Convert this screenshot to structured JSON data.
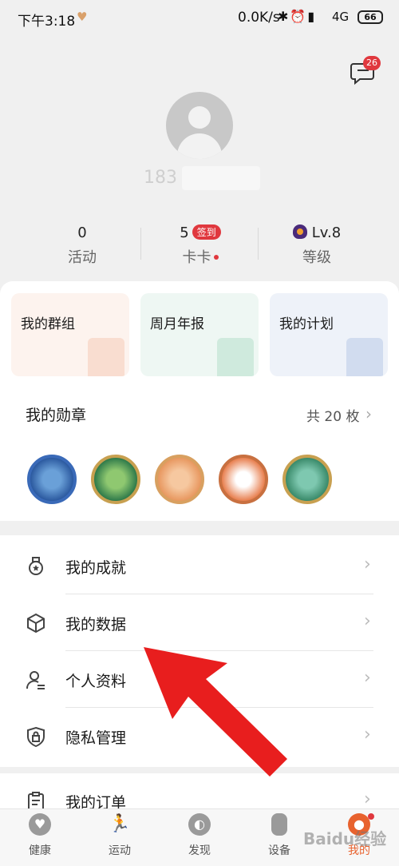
{
  "status_bar": {
    "time": "下午3:18",
    "net_speed": "0.0K/s",
    "network": "4G",
    "battery": "66"
  },
  "header": {
    "message_badge": "26",
    "username": "183"
  },
  "stats": [
    {
      "value": "0",
      "label": "活动"
    },
    {
      "value": "5",
      "badge": "签到",
      "label": "卡卡"
    },
    {
      "value": "Lv.8",
      "label": "等级"
    }
  ],
  "quick_cards": [
    "我的群组",
    "周月年报",
    "我的计划"
  ],
  "medals": {
    "title": "我的勋章",
    "count_text": "共 20 枚"
  },
  "menu": [
    {
      "label": "我的成就",
      "icon": "medal-icon"
    },
    {
      "label": "我的数据",
      "icon": "cube-icon"
    },
    {
      "label": "个人资料",
      "icon": "person-icon"
    },
    {
      "label": "隐私管理",
      "icon": "lock-icon"
    },
    {
      "label": "我的订单",
      "icon": "clipboard-icon"
    }
  ],
  "bottom_nav": [
    {
      "label": "健康",
      "icon": "heart-icon"
    },
    {
      "label": "运动",
      "icon": "run-icon"
    },
    {
      "label": "发现",
      "icon": "globe-icon"
    },
    {
      "label": "设备",
      "icon": "watch-icon"
    },
    {
      "label": "我的",
      "icon": "profile-icon",
      "active": true
    }
  ],
  "watermark": "Baidu经验",
  "colors": {
    "accent": "#e8622e",
    "badge_red": "#e0383e"
  }
}
